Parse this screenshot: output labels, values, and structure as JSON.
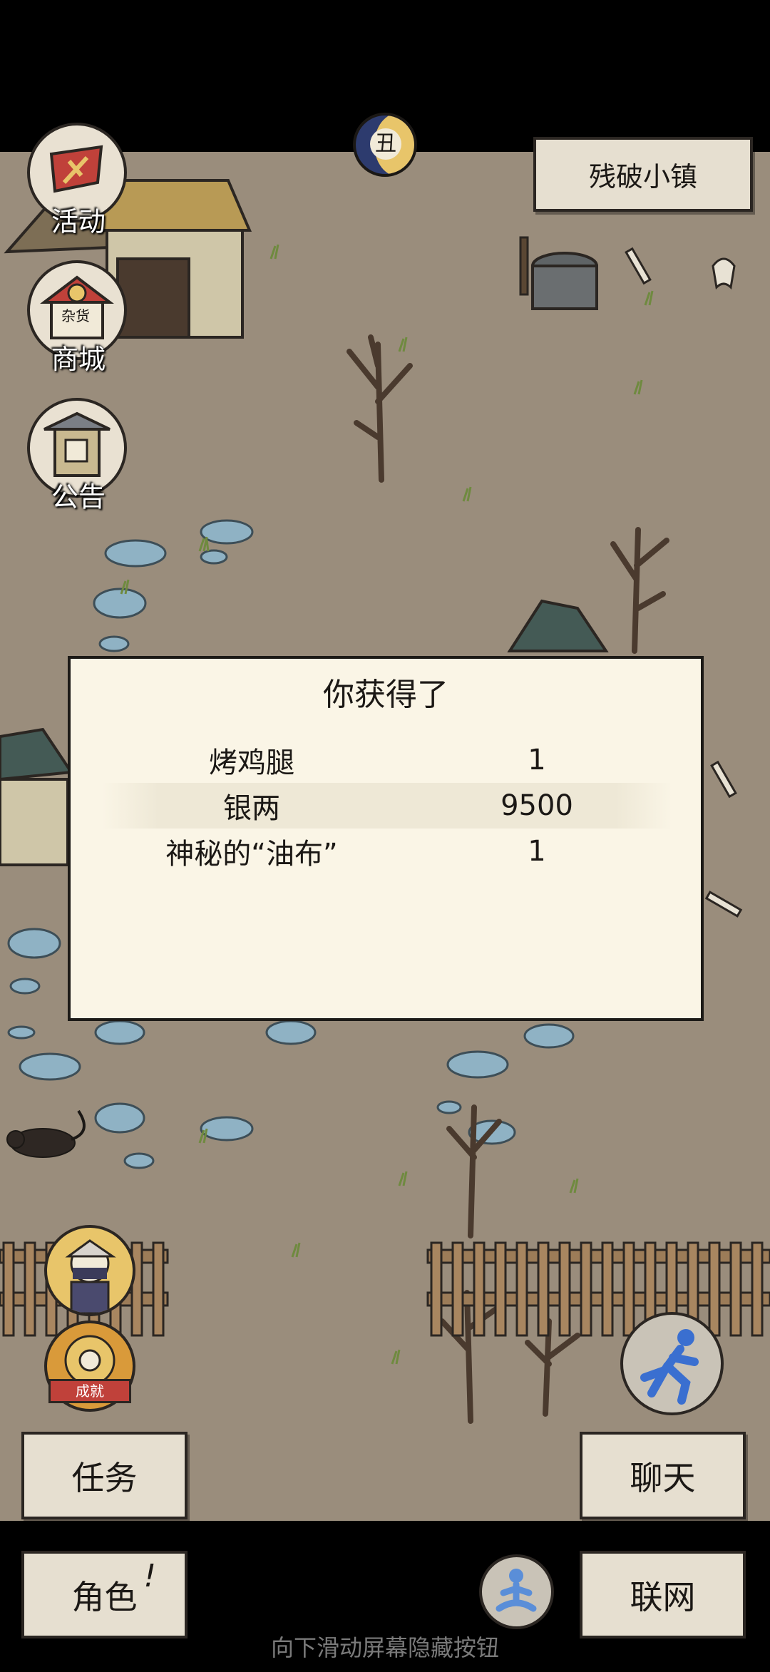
{
  "location": {
    "name": "残破小镇"
  },
  "hud": {
    "activity_label": "活动",
    "shop_label": "商城",
    "notice_label": "公告",
    "time_badge": "丑",
    "shop_sign": "杂货",
    "achievement_label": "成就"
  },
  "dialog": {
    "title": "你获得了",
    "rows": [
      {
        "name": "烤鸡腿",
        "qty": "1"
      },
      {
        "name": "银两",
        "qty": "9500"
      },
      {
        "name": "神秘的“油布”",
        "qty": "1"
      }
    ]
  },
  "buttons": {
    "quest": "任务",
    "chat": "聊天",
    "character": "角色",
    "character_badge": "!",
    "network": "联网"
  },
  "hint": "向下滑动屏幕隐藏按钮",
  "colors": {
    "ground": "#9a8d7c",
    "paper": "#faf5e6",
    "stone": "#8fb2c4"
  }
}
